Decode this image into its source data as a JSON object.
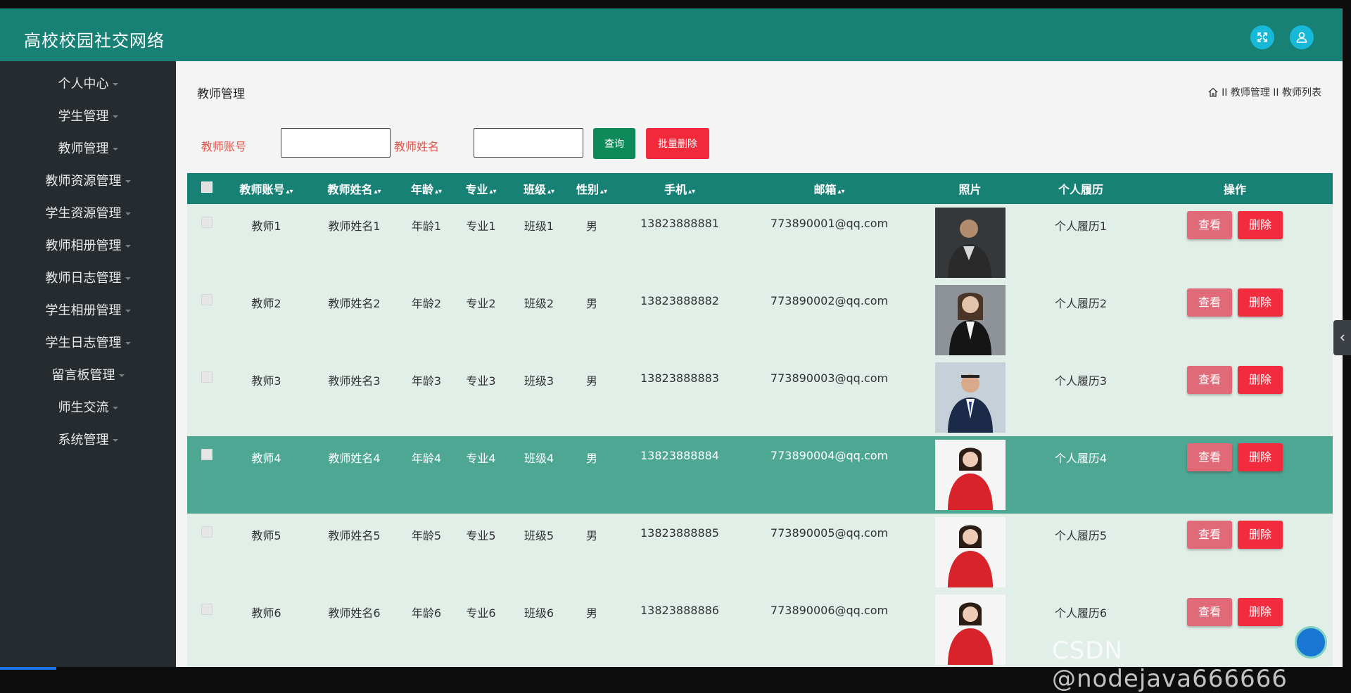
{
  "app": {
    "title": "高校校园社交网络"
  },
  "sidebar": {
    "items": [
      {
        "label": "个人中心"
      },
      {
        "label": "学生管理"
      },
      {
        "label": "教师管理"
      },
      {
        "label": "教师资源管理"
      },
      {
        "label": "学生资源管理"
      },
      {
        "label": "教师相册管理"
      },
      {
        "label": "教师日志管理"
      },
      {
        "label": "学生相册管理"
      },
      {
        "label": "学生日志管理"
      },
      {
        "label": "留言板管理"
      },
      {
        "label": "师生交流"
      },
      {
        "label": "系统管理"
      }
    ]
  },
  "page": {
    "title": "教师管理",
    "breadcrumb": "II 教师管理 II 教师列表"
  },
  "search": {
    "account_label": "教师账号",
    "name_label": "教师姓名",
    "account_value": "",
    "name_value": "",
    "query_label": "查询",
    "batch_delete_label": "批量删除"
  },
  "table": {
    "columns": [
      "教师账号",
      "教师姓名",
      "年龄",
      "专业",
      "班级",
      "性别",
      "手机",
      "邮箱",
      "照片",
      "个人履历",
      "操作"
    ],
    "view_label": "查看",
    "delete_label": "删除",
    "rows": [
      {
        "account": "教师1",
        "name": "教师姓名1",
        "age": "年龄1",
        "major": "专业1",
        "class": "班级1",
        "gender": "男",
        "phone": "13823888881",
        "email": "773890001@qq.com",
        "resume": "个人履历1"
      },
      {
        "account": "教师2",
        "name": "教师姓名2",
        "age": "年龄2",
        "major": "专业2",
        "class": "班级2",
        "gender": "男",
        "phone": "13823888882",
        "email": "773890002@qq.com",
        "resume": "个人履历2"
      },
      {
        "account": "教师3",
        "name": "教师姓名3",
        "age": "年龄3",
        "major": "专业3",
        "class": "班级3",
        "gender": "男",
        "phone": "13823888883",
        "email": "773890003@qq.com",
        "resume": "个人履历3"
      },
      {
        "account": "教师4",
        "name": "教师姓名4",
        "age": "年龄4",
        "major": "专业4",
        "class": "班级4",
        "gender": "男",
        "phone": "13823888884",
        "email": "773890004@qq.com",
        "resume": "个人履历4"
      },
      {
        "account": "教师5",
        "name": "教师姓名5",
        "age": "年龄5",
        "major": "专业5",
        "class": "班级5",
        "gender": "男",
        "phone": "13823888885",
        "email": "773890005@qq.com",
        "resume": "个人履历5"
      },
      {
        "account": "教师6",
        "name": "教师姓名6",
        "age": "年龄6",
        "major": "专业6",
        "class": "班级6",
        "gender": "男",
        "phone": "13823888886",
        "email": "773890006@qq.com",
        "resume": "个人履历6"
      }
    ]
  },
  "watermark": "CSDN @nodejava666666",
  "colors": {
    "header_bg": "#188176",
    "sidebar_bg": "#252b2f",
    "row_bg": "#e1efe8",
    "row_highlight": "#4ea793",
    "view_button": "#e06a77",
    "delete_button": "#f22c3e",
    "query_button": "#0e8a5a",
    "label_red": "#e0564a",
    "icon_button": "#18b8d8"
  },
  "icons": {
    "fullscreen": "fullscreen-icon",
    "user": "user-icon",
    "home": "home-icon",
    "collapse": "chevron-left-icon"
  }
}
